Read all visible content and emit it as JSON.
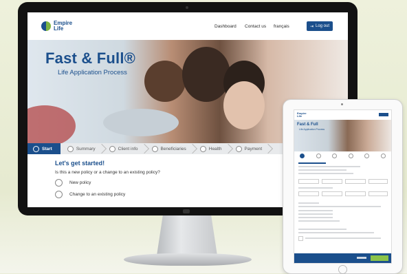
{
  "site": {
    "brand_line1": "Empire",
    "brand_line2": "Life",
    "nav": [
      "Dashboard",
      "Contact us",
      "français"
    ],
    "logout_label": "Log out",
    "accent": "#1b4f8c",
    "secondary": "#7cb342"
  },
  "hero": {
    "title": "Fast & Full®",
    "subtitle": "Life Application Process"
  },
  "steps": [
    "Start",
    "Summary",
    "Client info",
    "Beneficiaries",
    "Health",
    "Payment"
  ],
  "active_step": "Start",
  "form": {
    "title": "Let's get started!",
    "question": "Is this a new policy or a change to an existing policy?",
    "options": [
      "New policy",
      "Change to an existing policy"
    ]
  },
  "tablet": {
    "brand_line1": "Empire",
    "brand_line2": "Life",
    "title": "Fast & Full",
    "subtitle": "Life Application Process"
  }
}
